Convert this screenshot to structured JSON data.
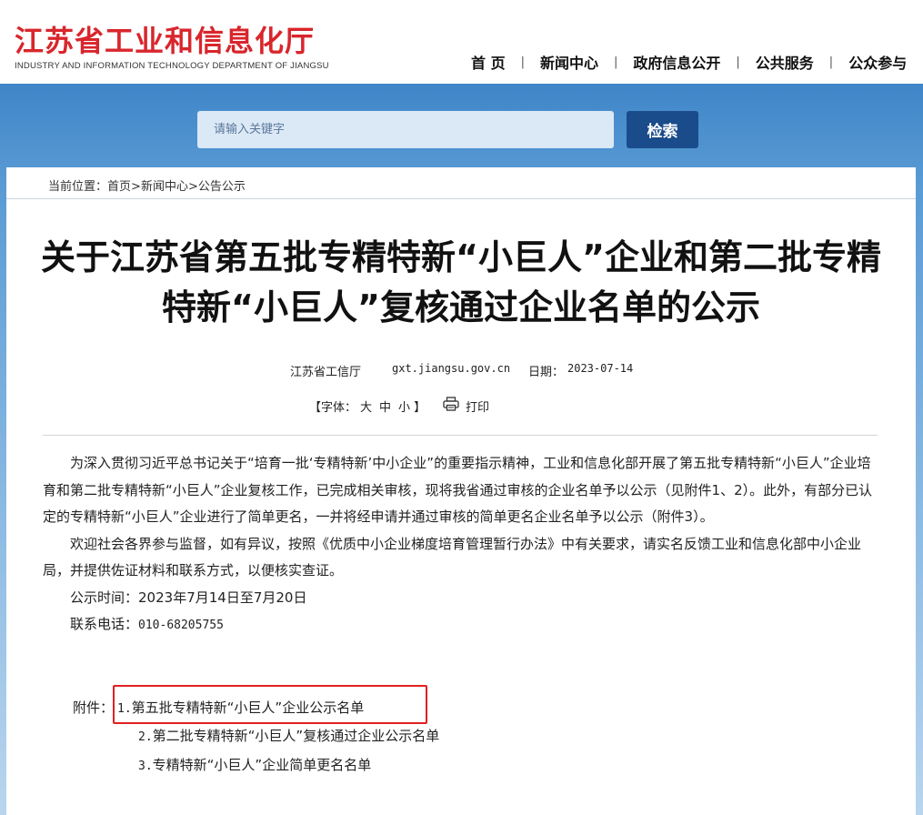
{
  "header": {
    "logo_cn": "江苏省工业和信息化厅",
    "logo_en": "INDUSTRY AND INFORMATION TECHNOLOGY DEPARTMENT OF JIANGSU",
    "nav": [
      "首 页",
      "新闻中心",
      "政府信息公开",
      "公共服务",
      "公众参与"
    ],
    "nav_sep": "|"
  },
  "search": {
    "placeholder": "请输入关键字",
    "button_label": "检索"
  },
  "breadcrumb": {
    "prefix": "当前位置：",
    "items": [
      "首页",
      "新闻中心",
      "公告公示"
    ],
    "sep": ">"
  },
  "article": {
    "title": "关于江苏省第五批专精特新“小巨人”企业和第二批专精特新“小巨人”复核通过企业名单的公示",
    "source": "江苏省工信厅",
    "site": "gxt.jiangsu.gov.cn",
    "date_label": "日期：",
    "date": "2023-07-14",
    "font_label": "【字体：",
    "font_sizes": [
      "大",
      "中",
      "小"
    ],
    "font_label_end": "】",
    "print_label": "打印",
    "para1": "为深入贯彻习近平总书记关于“培育一批‘专精特新’中小企业”的重要指示精神，工业和信息化部开展了第五批专精特新“小巨人”企业培育和第二批专精特新“小巨人”企业复核工作，已完成相关审核，现将我省通过审核的企业名单予以公示（见附件1、2）。此外，有部分已认定的专精特新“小巨人”企业进行了简单更名，一并将经申请并通过审核的简单更名企业名单予以公示（附件3）。",
    "para2": "欢迎社会各界参与监督，如有异议，按照《优质中小企业梯度培育管理暂行办法》中有关要求，请实名反馈工业和信息化部中小企业局，并提供佐证材料和联系方式，以便核实查证。",
    "period_label": "公示时间：",
    "period": "2023年7月14日至7月20日",
    "phone_label": "联系电话：",
    "phone": "010-68205755",
    "attach_label": "附件：",
    "attachments": [
      {
        "num": "1.",
        "text": "第五批专精特新“小巨人”企业公示名单"
      },
      {
        "num": "2.",
        "text": "第二批专精特新“小巨人”复核通过企业公示名单"
      },
      {
        "num": "3.",
        "text": "专精特新“小巨人”企业简单更名名单"
      }
    ]
  },
  "colors": {
    "brand_red": "#d8262c",
    "search_button": "#1a4b8a",
    "banner_blue": "#4f92cf",
    "highlight_box": "#e02020"
  },
  "icons": [
    "printer-icon"
  ]
}
